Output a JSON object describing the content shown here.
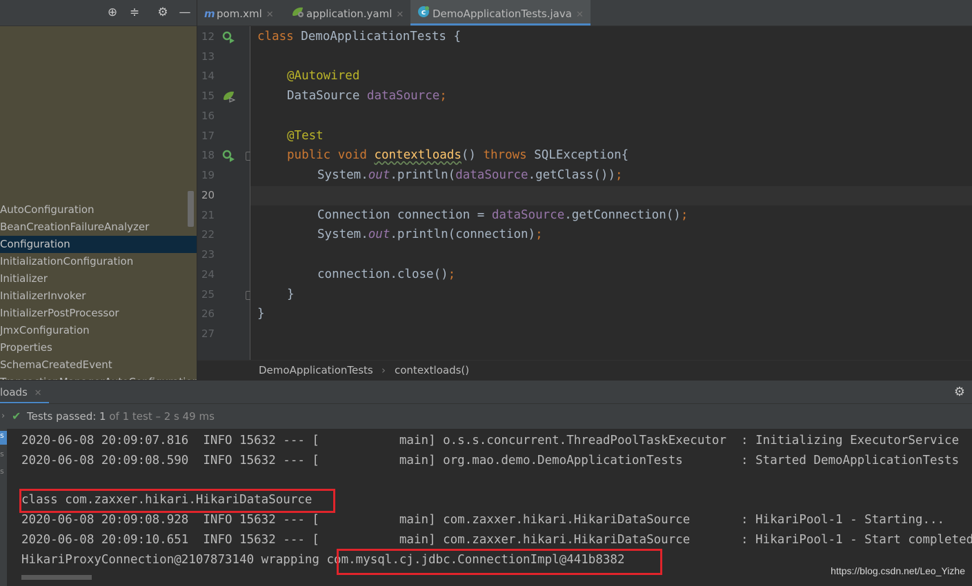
{
  "left_toolbar": {
    "icons": [
      "crosshair-icon",
      "collapse-icon",
      "gear-icon",
      "minimize-icon"
    ]
  },
  "left_panel": {
    "items": [
      "AutoConfiguration",
      "BeanCreationFailureAnalyzer",
      "Configuration",
      "InitializationConfiguration",
      "Initializer",
      "InitializerInvoker",
      "InitializerPostProcessor",
      "JmxConfiguration",
      "Properties",
      "SchemaCreatedEvent",
      "TransactionManagerAutoConfiguration"
    ],
    "selected_index": 2
  },
  "tabs": [
    {
      "label": "pom.xml",
      "icon": "maven-icon",
      "icon_glyph": "m"
    },
    {
      "label": "application.yaml",
      "icon": "spring-yaml-icon"
    },
    {
      "label": "DemoApplicationTests.java",
      "icon": "java-test-class-icon",
      "active": true
    }
  ],
  "editor": {
    "line_numbers": [
      "12",
      "13",
      "14",
      "15",
      "16",
      "17",
      "18",
      "19",
      "20",
      "21",
      "22",
      "23",
      "24",
      "25",
      "26",
      "27"
    ],
    "current_line": "20",
    "code": {
      "l12_kw": "class ",
      "l12_name": "DemoApplicationTests {",
      "l14_ann": "@Autowired",
      "l15_type": "DataSource ",
      "l15_field": "dataSource",
      "l15_semi": ";",
      "l17_ann": "@Test",
      "l18_kw1": "public void ",
      "l18_fn": "contextloads",
      "l18_paren": "() ",
      "l18_kw2": "throws ",
      "l18_rest": "SQLException{",
      "l19_a": "System.",
      "l19_out": "out",
      "l19_b": ".println(",
      "l19_field": "dataSource",
      "l19_c": ".getClass())",
      "l19_semi": ";",
      "l21_a": "Connection connection = ",
      "l21_field": "dataSource",
      "l21_b": ".getConnection()",
      "l21_semi": ";",
      "l22_a": "System.",
      "l22_out": "out",
      "l22_b": ".println(connection)",
      "l22_semi": ";",
      "l24_a": "connection.close()",
      "l24_semi": ";",
      "l25": "}",
      "l26": "}"
    }
  },
  "breadcrumb": {
    "class": "DemoApplicationTests",
    "sep": "›",
    "method": "contextloads()"
  },
  "run_panel": {
    "tab_label": "loads",
    "status_prefix": "Tests passed: ",
    "status_count": "1",
    "status_suffix": " of 1 test – 2 s 49 ms"
  },
  "console": {
    "lines": [
      "2020-06-08 20:09:07.816  INFO 15632 --- [           main] o.s.s.concurrent.ThreadPoolTaskExecutor  : Initializing ExecutorService",
      "2020-06-08 20:09:08.590  INFO 15632 --- [           main] org.mao.demo.DemoApplicationTests        : Started DemoApplicationTests",
      "",
      "class com.zaxxer.hikari.HikariDataSource",
      "2020-06-08 20:09:08.928  INFO 15632 --- [           main] com.zaxxer.hikari.HikariDataSource       : HikariPool-1 - Starting...",
      "2020-06-08 20:09:10.651  INFO 15632 --- [           main] com.zaxxer.hikari.HikariDataSource       : HikariPool-1 - Start completed."
    ],
    "last_line_prefix": "HikariProxyConnection@2107873140 wrapping ",
    "last_line_highlight": "com.mysql.cj.jdbc.ConnectionImpl@441b8382"
  },
  "watermark": "https://blog.csdn.net/Leo_Yizhe",
  "colors": {
    "highlight_box": "#e0242b",
    "keyword": "#cc7832",
    "annotation": "#bbb529",
    "field": "#9876aa",
    "method": "#ffc66d"
  }
}
